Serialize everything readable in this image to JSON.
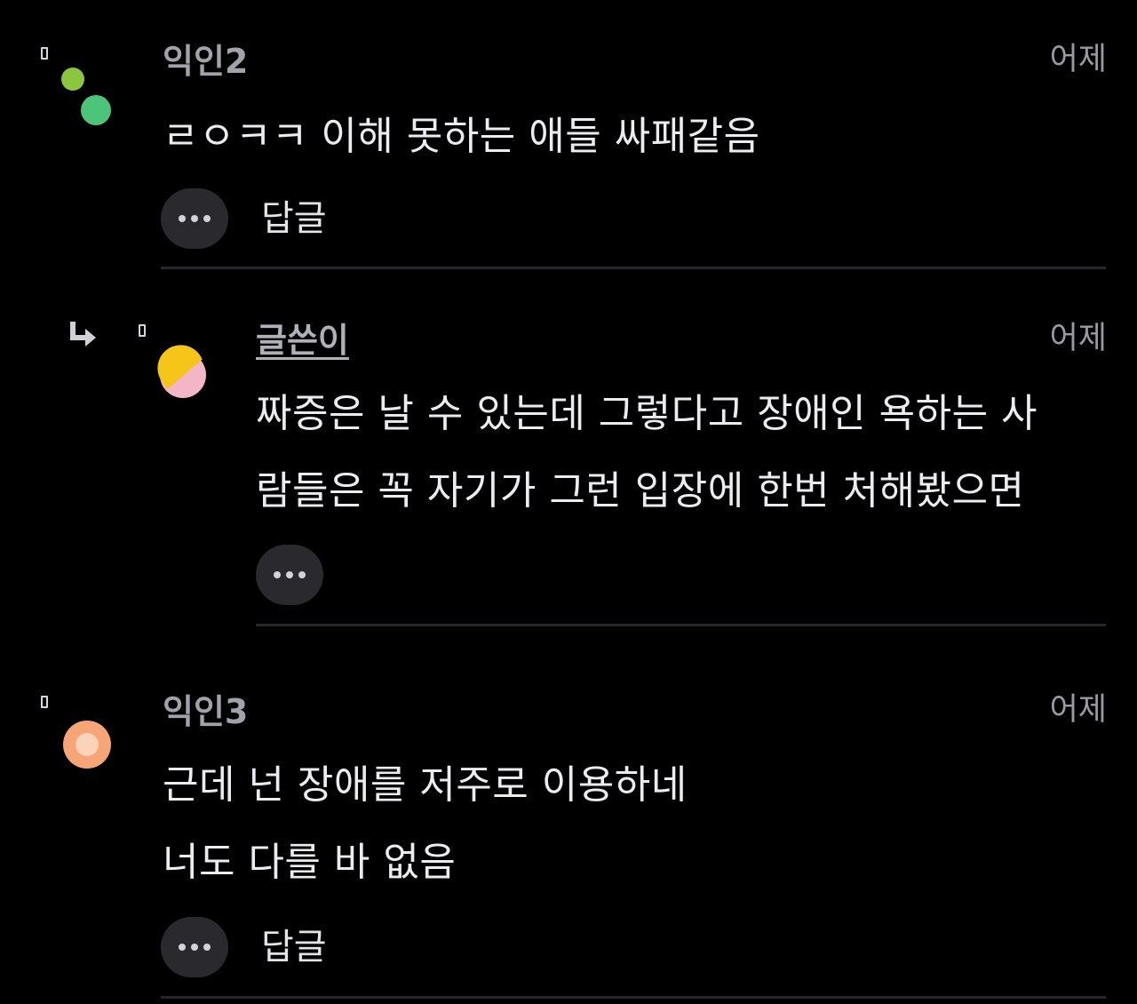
{
  "comments": [
    {
      "author": "익인2",
      "time": "어제",
      "lines": [
        "ㄹㅇㅋㅋ 이해 못하는 애들 싸패같음"
      ],
      "reply_label": "답글"
    },
    {
      "author": "글쓴이",
      "time": "어제",
      "lines": [
        "짜증은 날 수 있는데 그렇다고 장애인 욕하는 사",
        "람들은 꼭 자기가 그런 입장에 한번 처해봤으면"
      ]
    },
    {
      "author": "익인3",
      "time": "어제",
      "lines": [
        "근데 넌 장애를 저주로 이용하네",
        "너도 다를 바 없음"
      ],
      "reply_label": "답글"
    }
  ],
  "colors": {
    "background": "#000000",
    "avatar_green_light": "#8cc63f",
    "avatar_green": "#4cc57a",
    "avatar_yellow": "#f5c518",
    "avatar_pink": "#f2b6c6",
    "avatar_orange": "#f7a477",
    "avatar_orange_inner": "#fcd3b8"
  },
  "icons": {
    "marker": "bookmark-marker-icon",
    "reply_arrow": "reply-arrow-icon",
    "more": "more-dots-icon"
  }
}
